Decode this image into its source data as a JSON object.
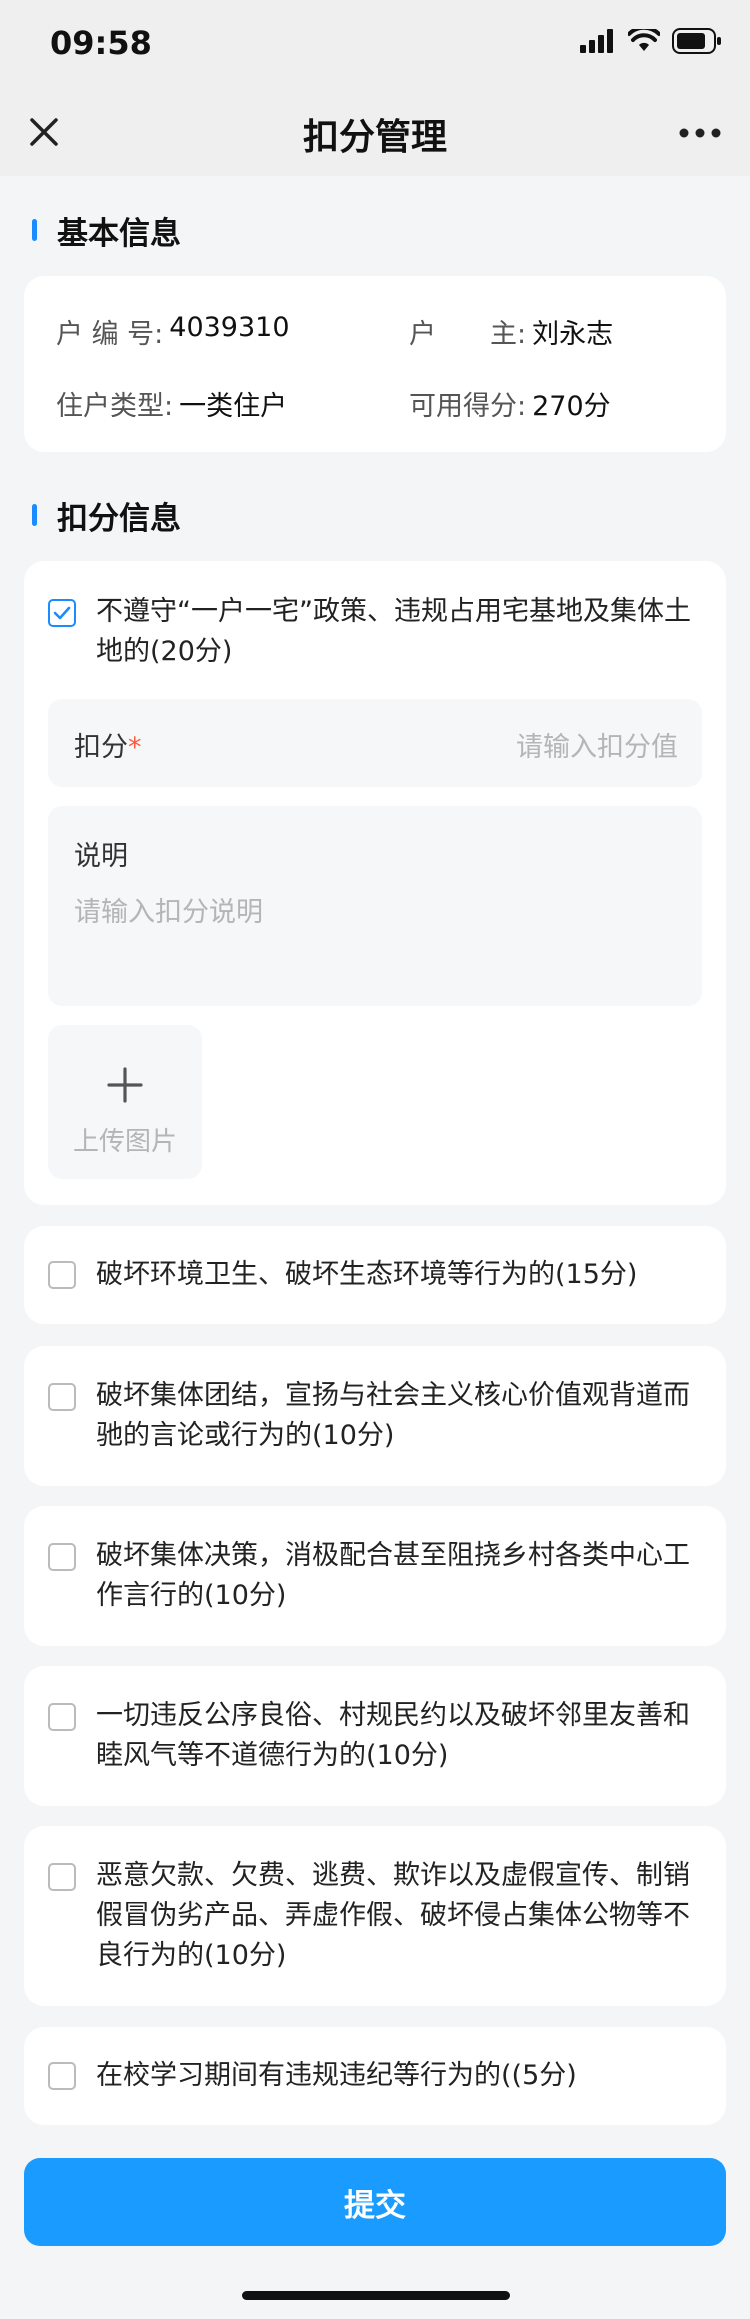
{
  "status": {
    "time": "09:58"
  },
  "nav": {
    "title": "扣分管理",
    "close_icon": "close-icon",
    "more_icon": "more-icon"
  },
  "sections": {
    "basic": "基本信息",
    "deduct": "扣分信息"
  },
  "household": {
    "no_label": "户 编 号:",
    "no_value": "4039310",
    "owner_label": "户　　主:",
    "owner_value": "刘永志",
    "type_label": "住户类型:",
    "type_value": "一类住户",
    "score_label": "可用得分:",
    "score_value": "270分"
  },
  "items": [
    {
      "text": "不遵守“一户一宅”政策、违规占用宅基地及集体土地的(20分)",
      "checked": true
    },
    {
      "text": "破坏环境卫生、破坏生态环境等行为的(15分)",
      "checked": false
    },
    {
      "text": "破坏集体团结，宣扬与社会主义核心价值观背道而驰的言论或行为的(10分)",
      "checked": false
    },
    {
      "text": "破坏集体决策，消极配合甚至阻挠乡村各类中心工作言行的(10分)",
      "checked": false
    },
    {
      "text": "一切违反公序良俗、村规民约以及破坏邻里友善和睦风气等不道德行为的(10分)",
      "checked": false
    },
    {
      "text": "恶意欠款、欠费、逃费、欺诈以及虚假宣传、制销假冒伪劣产品、弄虚作假、破坏侵占集体公物等不良行为的(10分)",
      "checked": false
    },
    {
      "text": "在校学习期间有违规违纪等行为的((5分)",
      "checked": false
    }
  ],
  "form": {
    "score_label": "扣分",
    "required_mark": "*",
    "score_placeholder": "请输入扣分值",
    "desc_label": "说明",
    "desc_placeholder": "请输入扣分说明",
    "upload_label": "上传图片"
  },
  "submit_label": "提交",
  "colors": {
    "accent": "#1a9bff",
    "required": "#ff5a3c"
  }
}
